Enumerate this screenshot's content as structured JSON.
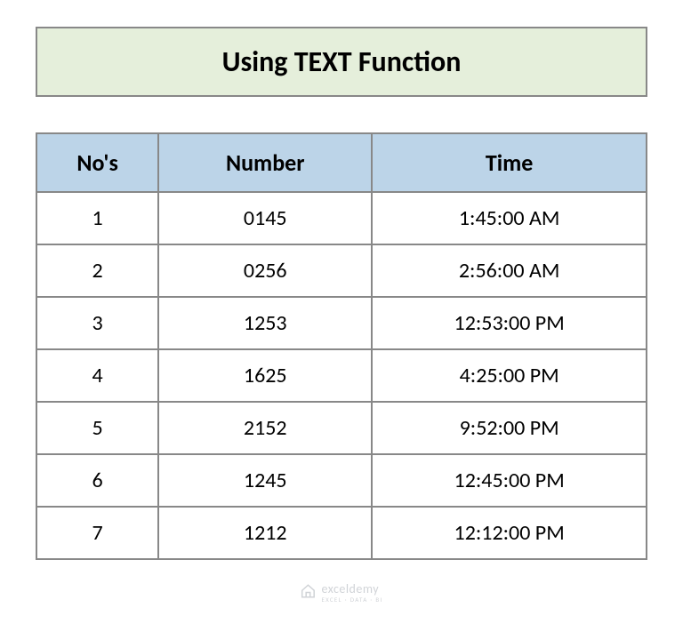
{
  "title": "Using TEXT Function",
  "table": {
    "headers": {
      "nos": "No's",
      "number": "Number",
      "time": "Time"
    },
    "rows": [
      {
        "nos": "1",
        "number": "0145",
        "time": "1:45:00 AM"
      },
      {
        "nos": "2",
        "number": "0256",
        "time": "2:56:00 AM"
      },
      {
        "nos": "3",
        "number": "1253",
        "time": "12:53:00 PM"
      },
      {
        "nos": "4",
        "number": "1625",
        "time": "4:25:00 PM"
      },
      {
        "nos": "5",
        "number": "2152",
        "time": "9:52:00 PM"
      },
      {
        "nos": "6",
        "number": "1245",
        "time": "12:45:00 PM"
      },
      {
        "nos": "7",
        "number": "1212",
        "time": "12:12:00 PM"
      }
    ]
  },
  "watermark": {
    "main": "exceldemy",
    "sub": "EXCEL · DATA · BI"
  }
}
